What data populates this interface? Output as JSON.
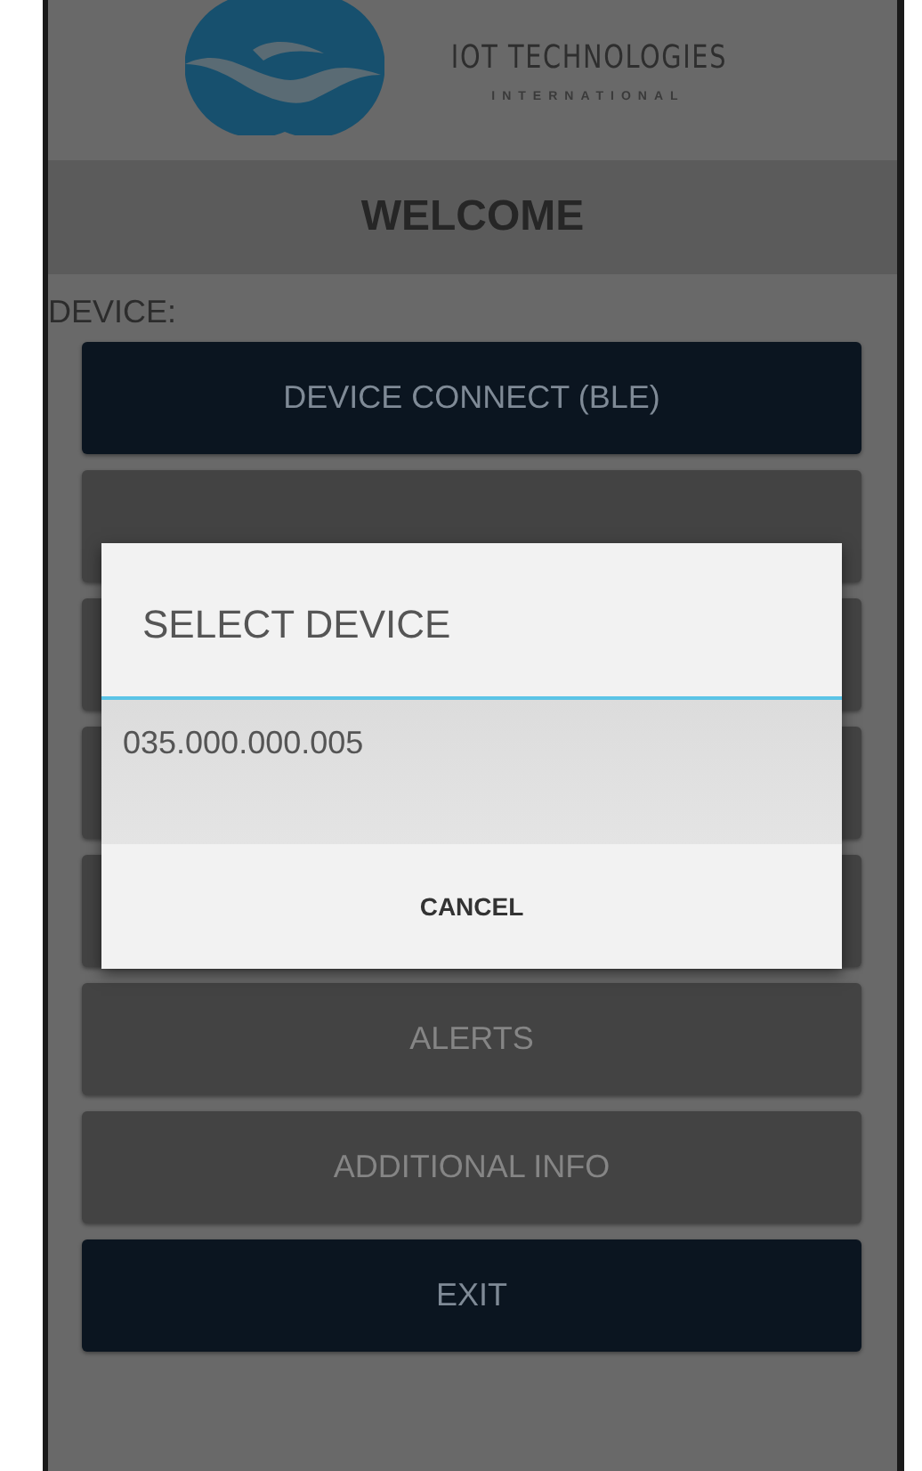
{
  "logo": {
    "name": "IOT TECHNOLOGIES",
    "tagline": "INTERNATIONAL"
  },
  "header": {
    "title": "WELCOME"
  },
  "section_label": "DEVICE:",
  "buttons": [
    {
      "label": "DEVICE CONNECT (BLE)",
      "kind": "primary"
    },
    {
      "kind": "disabled"
    },
    {
      "kind": "disabled"
    },
    {
      "kind": "disabled"
    },
    {
      "kind": "disabled"
    },
    {
      "label": "ALERTS",
      "kind": "disabled"
    },
    {
      "label": "ADDITIONAL INFO",
      "kind": "disabled"
    },
    {
      "label": "EXIT",
      "kind": "primary"
    }
  ],
  "dialog": {
    "title": "SELECT DEVICE",
    "items": [
      {
        "label": "035.000.000.005"
      }
    ],
    "actions": [
      "CANCEL"
    ]
  }
}
